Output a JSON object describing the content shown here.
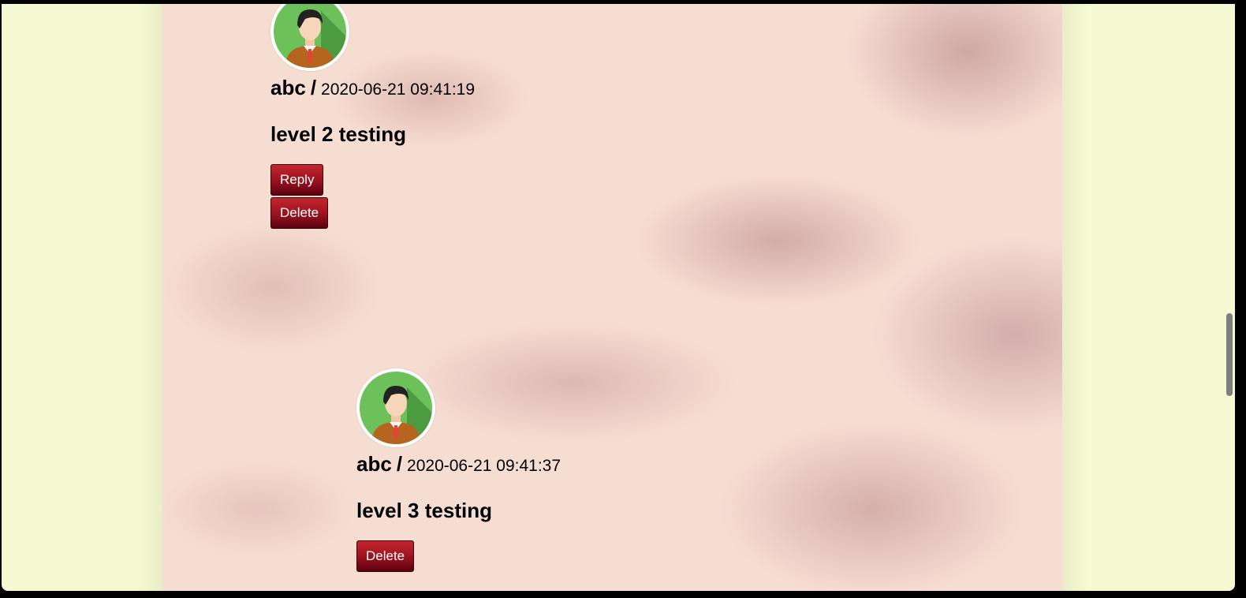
{
  "comments": [
    {
      "user": "abc",
      "separator": "/",
      "timestamp": "2020-06-21 09:41:19",
      "text": "level 2 testing",
      "reply_label": "Reply",
      "delete_label": "Delete",
      "level": 2
    },
    {
      "user": "abc",
      "separator": "/",
      "timestamp": "2020-06-21 09:41:37",
      "text": "level 3 testing",
      "delete_label": "Delete",
      "level": 3
    }
  ],
  "icons": {
    "avatar": "user-avatar-icon"
  },
  "colors": {
    "page_background": "#f5fad3",
    "button_top": "#c3272e",
    "button_bottom": "#5c0210",
    "avatar_green": "#5cb85c",
    "tie_red": "#e8413b"
  }
}
